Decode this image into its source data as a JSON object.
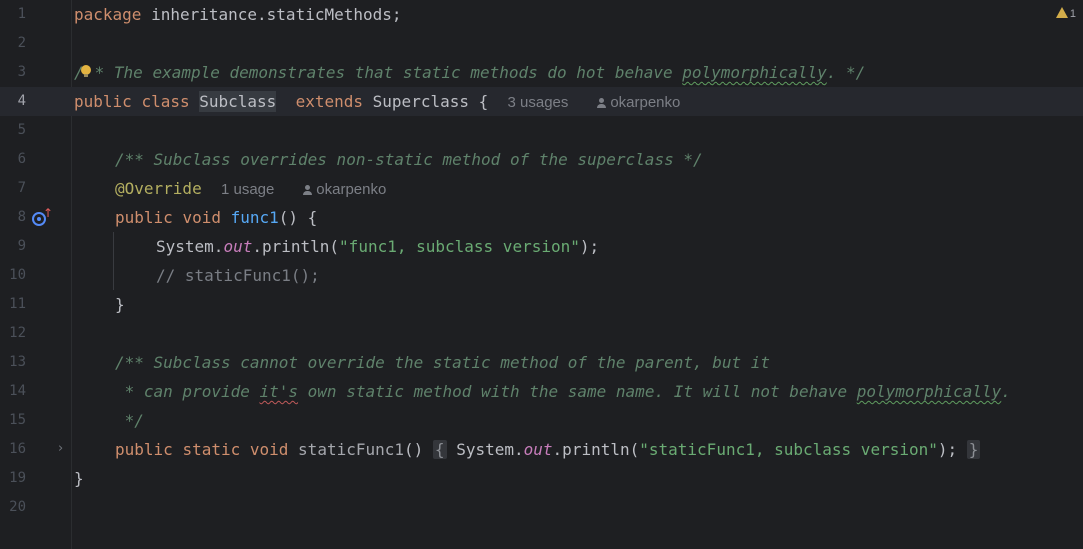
{
  "editor": {
    "line_numbers": [
      "1",
      "2",
      "3",
      "4",
      "5",
      "6",
      "7",
      "8",
      "9",
      "10",
      "11",
      "12",
      "13",
      "14",
      "15",
      "16",
      "19",
      "20"
    ],
    "warnings": {
      "count": "1",
      "icon": "warning-icon",
      "color": "#d3ad4a"
    },
    "colors": {
      "background": "#1e1f22",
      "keyword": "#cf8e6d",
      "string": "#6aab73",
      "function": "#56a8f5",
      "static_field": "#c77dbb",
      "annotation": "#b3ae60",
      "doc_comment": "#5f826b",
      "comment": "#7a7e85"
    },
    "lines": {
      "l1": {
        "kw": "package",
        "rest": " inheritance.staticMethods;"
      },
      "l3": {
        "c1": "/",
        "c2": "* The example demonstrates that static methods do hot behave ",
        "typo": "polymorphically",
        "c3": ". */"
      },
      "l4": {
        "kw1": "public",
        "kw2": "class",
        "name": "Subclass",
        "kw3": "extends",
        "parent": "Superclass {",
        "usages": "3 usages",
        "author": "okarpenko"
      },
      "l6": {
        "doc": "/** Subclass overrides non-static method of the superclass */"
      },
      "l7": {
        "ann": "@Override",
        "usages": "1 usage",
        "author": "okarpenko"
      },
      "l8": {
        "kw1": "public",
        "kw2": "void",
        "fn": "func1",
        "rest": "() {"
      },
      "l9": {
        "a": "System.",
        "field": "out",
        "b": ".println(",
        "str": "\"func1, subclass version\"",
        "c": ");"
      },
      "l10": {
        "cm": "// staticFunc1();"
      },
      "l11": {
        "text": "}"
      },
      "l13": {
        "doc": "/** Subclass cannot override the static method of the parent, but it"
      },
      "l14": {
        "d1": " * can provide ",
        "typo": "it's",
        "d2": " own static method with the same name. It will not behave ",
        "typo2": "polymorphically",
        "d3": "."
      },
      "l15": {
        "doc": " */"
      },
      "l16": {
        "kw1": "public",
        "kw2": "static",
        "kw3": "void",
        "fn": "staticFunc1",
        "paren": "()",
        "ob": "{",
        "a": "System.",
        "field": "out",
        "b": ".println(",
        "str": "\"staticFunc1, subclass version\"",
        "c": ");",
        "cb": "}"
      },
      "l19": {
        "text": "}"
      }
    }
  }
}
